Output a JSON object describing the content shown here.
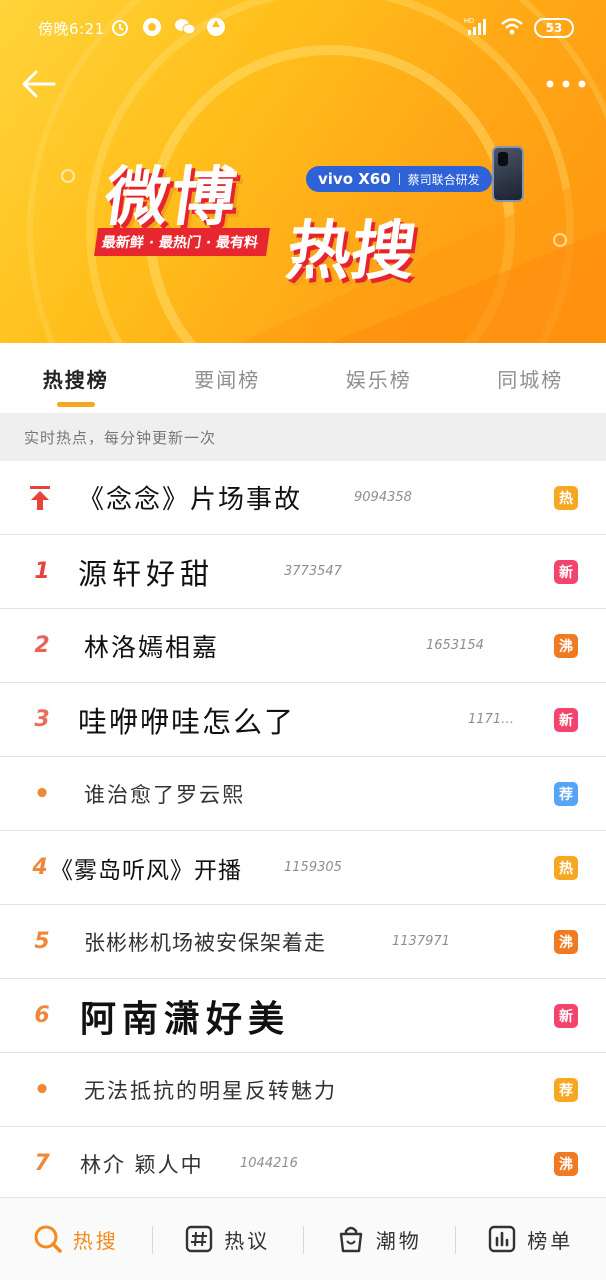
{
  "status_bar": {
    "time": "傍晚6:21",
    "battery": "53",
    "hd": "HD"
  },
  "banner": {
    "title_line1": "微博",
    "title_line2": "热搜",
    "slogan": "最新鲜 · 最热门 · 最有料",
    "sponsor_model": "vivo X60",
    "sponsor_collab": "蔡司联合研发",
    "colors": {
      "gradient_start": "#ffd43a",
      "gradient_end": "#ff9410",
      "logo_red": "#e8262f",
      "sponsor_blue": "#2e62d6"
    }
  },
  "tabs": [
    {
      "label": "热搜榜",
      "active": true
    },
    {
      "label": "要闻榜",
      "active": false
    },
    {
      "label": "娱乐榜",
      "active": false
    },
    {
      "label": "同城榜",
      "active": false
    }
  ],
  "subheader": "实时热点，每分钟更新一次",
  "list": [
    {
      "rank": "",
      "title": "《念念》片场事故",
      "count": "9094358",
      "badge": "热",
      "badge_type": "hot",
      "pinned": true
    },
    {
      "rank": "1",
      "title": "源轩好甜",
      "count": "3773547",
      "badge": "新",
      "badge_type": "new"
    },
    {
      "rank": "2",
      "title": "林洛嫣相嘉",
      "count": "1653154",
      "badge": "沸",
      "badge_type": "boil"
    },
    {
      "rank": "3",
      "title": "哇咿咿哇怎么了",
      "count": "1171…",
      "badge": "新",
      "badge_type": "new"
    },
    {
      "rank": "•",
      "title": "谁治愈了罗云熙",
      "count": "",
      "badge": "荐",
      "badge_type": "rec"
    },
    {
      "rank": "4",
      "title": "《雾岛听风》开播",
      "count": "1159305",
      "badge": "热",
      "badge_type": "hot"
    },
    {
      "rank": "5",
      "title": "张彬彬机场被安保架着走",
      "count": "1137971",
      "badge": "沸",
      "badge_type": "boil"
    },
    {
      "rank": "6",
      "title": "阿南潇好美",
      "count": "",
      "badge": "新",
      "badge_type": "new"
    },
    {
      "rank": "•",
      "title": "无法抵抗的明星反转魅力",
      "count": "",
      "badge": "荐",
      "badge_type": "rec2"
    },
    {
      "rank": "7",
      "title": "林介 颖人中",
      "count": "1044216",
      "badge": "沸",
      "badge_type": "boil"
    }
  ],
  "bottom_nav": [
    {
      "label": "热搜",
      "icon": "search-icon",
      "active": true
    },
    {
      "label": "热议",
      "icon": "hashtag-icon",
      "active": false
    },
    {
      "label": "潮物",
      "icon": "shopping-bag-icon",
      "active": false
    },
    {
      "label": "榜单",
      "icon": "chart-icon",
      "active": false
    }
  ]
}
